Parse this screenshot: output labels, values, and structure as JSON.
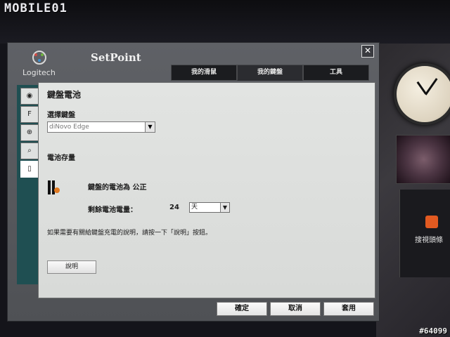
{
  "watermark": {
    "site": "MOBILE01",
    "photo_id": "#64099"
  },
  "app": {
    "brand": "Logitech",
    "title": "SetPoint"
  },
  "tabs": [
    {
      "label": "我的滑鼠",
      "active": false
    },
    {
      "label": "我的鍵盤",
      "active": true
    },
    {
      "label": "工具",
      "active": false
    }
  ],
  "rail": {
    "icons": [
      {
        "name": "keyboard-settings",
        "glyph": "◉"
      },
      {
        "name": "function-key",
        "glyph": "F"
      },
      {
        "name": "zoom",
        "glyph": "⊕"
      },
      {
        "name": "search",
        "glyph": "⌕"
      },
      {
        "name": "battery",
        "glyph": "▯"
      }
    ],
    "selected_index": 4
  },
  "panel": {
    "heading": "鍵盤電池",
    "select_keyboard_label": "選擇鍵盤",
    "keyboard_selected": "diNovo Edge",
    "battery_section_label": "電池存量",
    "battery_status": "鍵盤的電池為 公正",
    "remaining_label": "剩餘電池電量：",
    "remaining_value": "24",
    "remaining_unit": "天",
    "help_text": "如果需要有關給鍵盤充電的說明，請按一下「說明」按鈕。",
    "help_button": "說明"
  },
  "buttons": {
    "ok": "確定",
    "cancel": "取消",
    "apply": "套用"
  },
  "desktop": {
    "feed_label": "搜視頭條"
  },
  "colors": {
    "rail": "#1f4f52",
    "tab_bar": "#1b1c1f",
    "panel_bg": "#e2e4e2"
  }
}
